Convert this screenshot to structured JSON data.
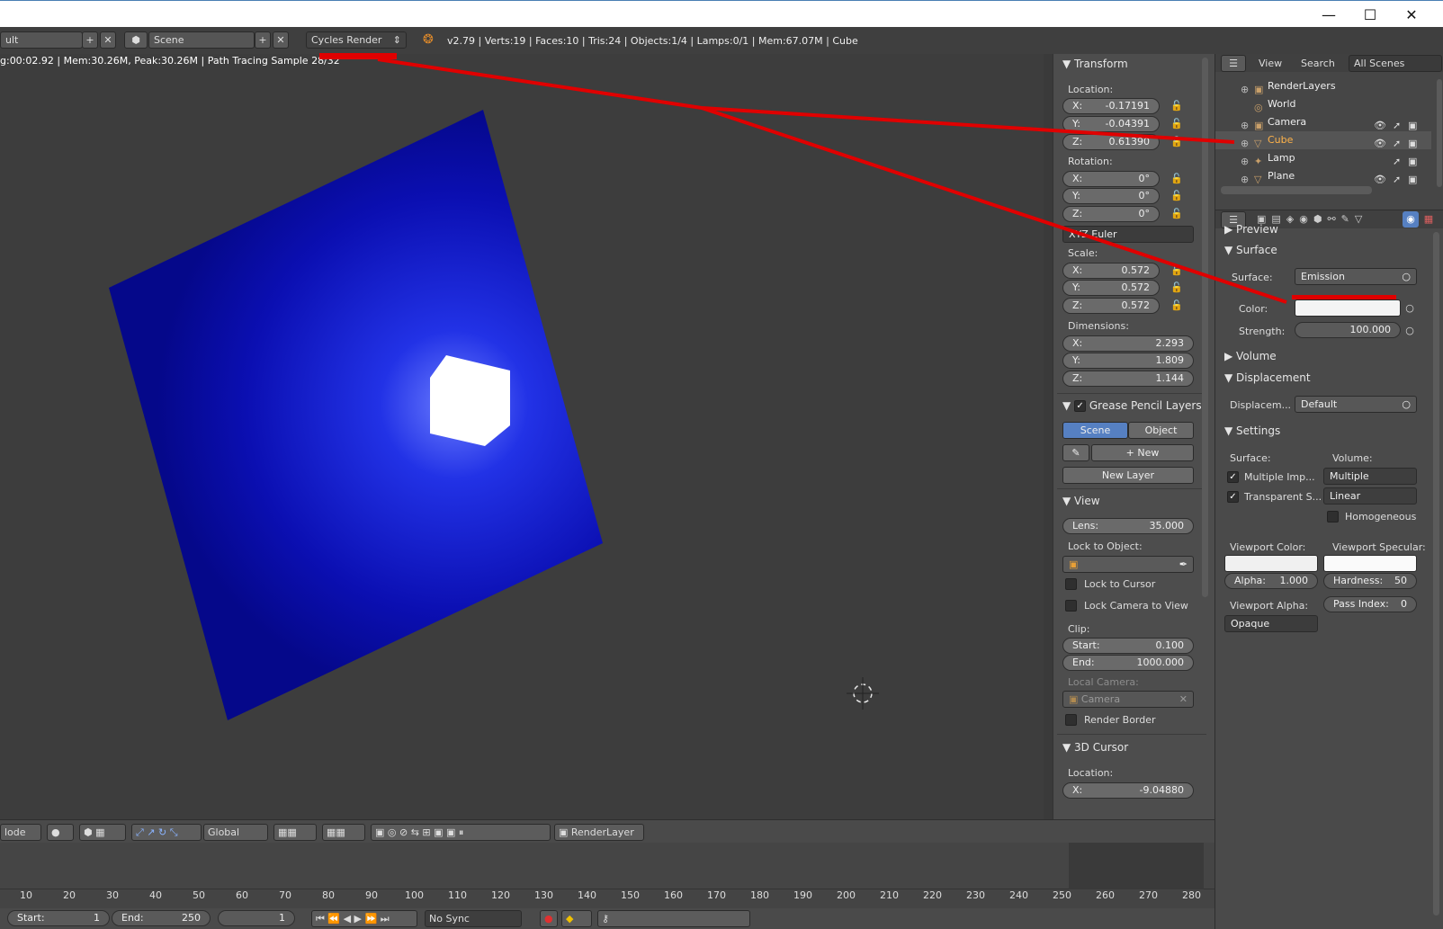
{
  "window": {
    "minimize": "—",
    "maximize": "☐",
    "close": "✕"
  },
  "info": {
    "screen_layout": "ult",
    "scene": "Scene",
    "render_engine": "Cycles Render",
    "stats": "v2.79 | Verts:19 | Faces:10 | Tris:24 | Objects:1/4 | Lamps:0/1 | Mem:67.07M | Cube"
  },
  "viewport": {
    "status": "g:00:02.92 | Mem:30.26M, Peak:30.26M | Path Tracing Sample 28/32"
  },
  "transform": {
    "title": "Transform",
    "location_label": "Location:",
    "location": [
      {
        "k": "X:",
        "v": "-0.17191"
      },
      {
        "k": "Y:",
        "v": "-0.04391"
      },
      {
        "k": "Z:",
        "v": "0.61390"
      }
    ],
    "rotation_label": "Rotation:",
    "rotation": [
      {
        "k": "X:",
        "v": "0°"
      },
      {
        "k": "Y:",
        "v": "0°"
      },
      {
        "k": "Z:",
        "v": "0°"
      }
    ],
    "rotation_mode": "XYZ Euler",
    "scale_label": "Scale:",
    "scale": [
      {
        "k": "X:",
        "v": "0.572"
      },
      {
        "k": "Y:",
        "v": "0.572"
      },
      {
        "k": "Z:",
        "v": "0.572"
      }
    ],
    "dimensions_label": "Dimensions:",
    "dimensions": [
      {
        "k": "X:",
        "v": "2.293"
      },
      {
        "k": "Y:",
        "v": "1.809"
      },
      {
        "k": "Z:",
        "v": "1.144"
      }
    ]
  },
  "grease_pencil": {
    "title": "Grease Pencil Layers",
    "tab_scene": "Scene",
    "tab_object": "Object",
    "new": "New",
    "new_layer": "New Layer"
  },
  "view": {
    "title": "View",
    "lens_label": "Lens:",
    "lens": "35.000",
    "lock_to_object": "Lock to Object:",
    "lock_to_cursor": "Lock to Cursor",
    "lock_camera": "Lock Camera to View",
    "clip": "Clip:",
    "clip_start_label": "Start:",
    "clip_start": "0.100",
    "clip_end_label": "End:",
    "clip_end": "1000.000",
    "local_camera": "Local Camera:",
    "camera": "Camera",
    "render_border": "Render Border"
  },
  "cursor": {
    "title": "3D Cursor",
    "location_label": "Location:",
    "x_label": "X:",
    "x": "-9.04880"
  },
  "outliner": {
    "view": "View",
    "search": "Search",
    "filter": "All Scenes",
    "items": [
      "RenderLayers",
      "World",
      "Camera",
      "Cube",
      "Lamp",
      "Plane"
    ]
  },
  "properties": {
    "preview": "Preview",
    "surface": "Surface",
    "surface_label": "Surface:",
    "surface_value": "Emission",
    "color_label": "Color:",
    "strength_label": "Strength:",
    "strength": "100.000",
    "volume": "Volume",
    "displacement": "Displacement",
    "displacement_label": "Displacem...",
    "displacement_value": "Default",
    "settings": "Settings",
    "settings_surface": "Surface:",
    "settings_volume": "Volume:",
    "multiple_imp": "Multiple Imp...",
    "multiple_import": "Multiple Import...",
    "transparent": "Transparent S...",
    "linear": "Linear",
    "homogeneous": "Homogeneous",
    "viewport_color": "Viewport Color:",
    "viewport_specular": "Viewport Specular:",
    "alpha_label": "Alpha:",
    "alpha": "1.000",
    "hardness_label": "Hardness:",
    "hardness": "50",
    "viewport_alpha": "Viewport Alpha:",
    "pass_index_label": "Pass Index:",
    "pass_index": "0",
    "blend": "Opaque"
  },
  "vpheader": {
    "mode": "lode",
    "orientation": "Global",
    "render_layer": "RenderLayer"
  },
  "timeline": {
    "ticks": [
      "10",
      "20",
      "30",
      "40",
      "50",
      "60",
      "70",
      "80",
      "90",
      "100",
      "110",
      "120",
      "130",
      "140",
      "150",
      "160",
      "170",
      "180",
      "190",
      "200",
      "210",
      "220",
      "230",
      "240",
      "250",
      "260",
      "270",
      "280"
    ],
    "start_label": "Start:",
    "start": "1",
    "end_label": "End:",
    "end": "250",
    "current": "1",
    "sync": "No Sync"
  },
  "colors": {
    "annotation": "#e00000",
    "plane": "#0a0fb0",
    "panel": "#4d4d4d"
  }
}
